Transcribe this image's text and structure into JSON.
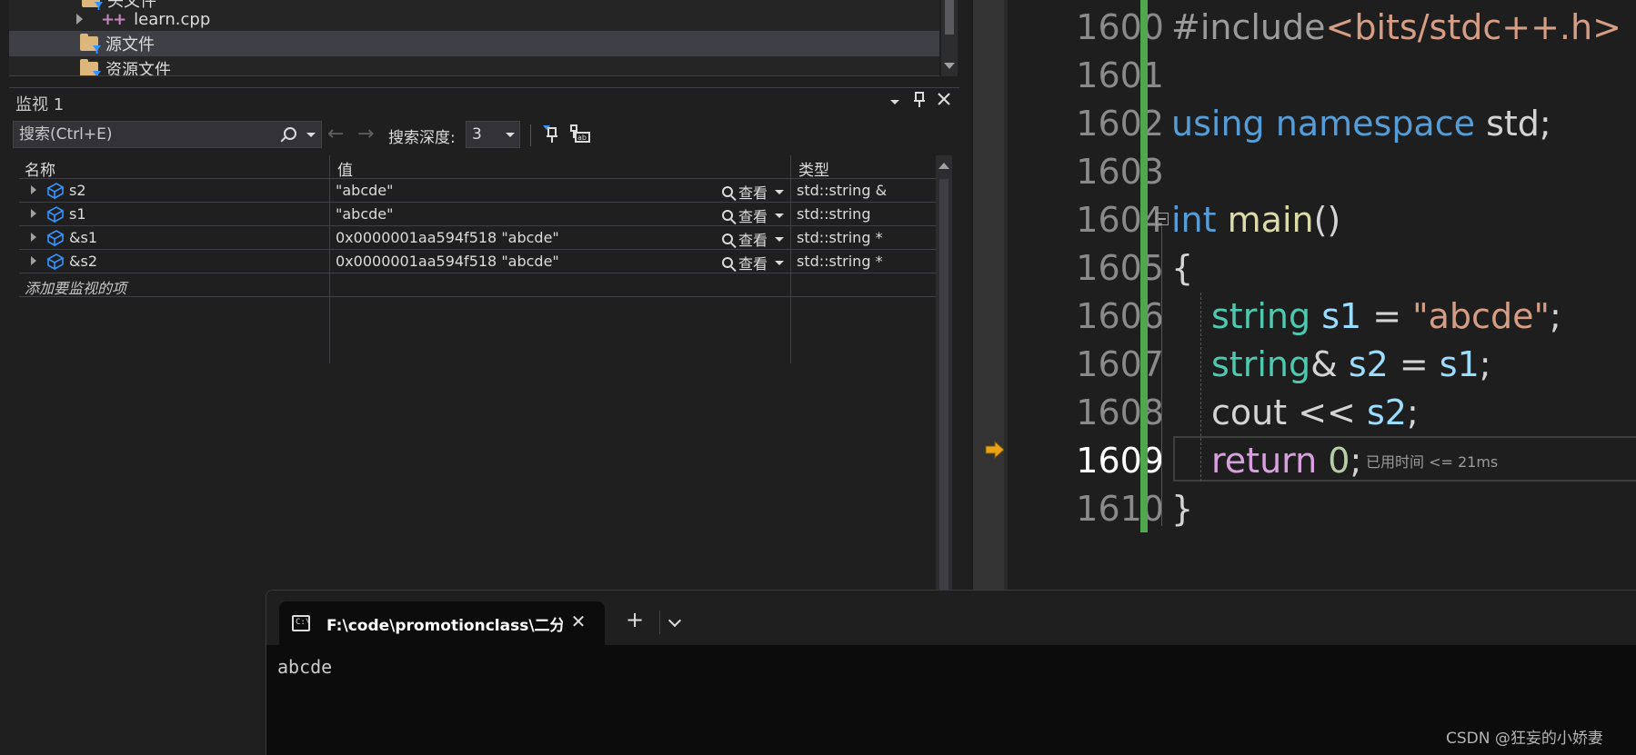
{
  "solution_explorer": {
    "items": [
      {
        "label": "头文件"
      },
      {
        "label": "learn.cpp"
      },
      {
        "label": "源文件"
      },
      {
        "label": "资源文件"
      }
    ]
  },
  "watch": {
    "title": "监视 1",
    "search_placeholder": "搜索(Ctrl+E)",
    "depth_label": "搜索深度:",
    "depth_value": "3",
    "columns": {
      "name": "名称",
      "value": "值",
      "type": "类型"
    },
    "view_label": "查看",
    "rows": [
      {
        "name": "s2",
        "value": "\"abcde\"",
        "type": "std::string &"
      },
      {
        "name": "s1",
        "value": "\"abcde\"",
        "type": "std::string"
      },
      {
        "name": "&s1",
        "value": "0x0000001aa594f518 \"abcde\"",
        "type": "std::string *"
      },
      {
        "name": "&s2",
        "value": "0x0000001aa594f518 \"abcde\"",
        "type": "std::string *"
      }
    ],
    "add_item": "添加要监视的项"
  },
  "editor": {
    "line_numbers": [
      "1600",
      "1601",
      "1602",
      "1603",
      "1604",
      "1605",
      "1606",
      "1607",
      "1608",
      "1609",
      "1610"
    ],
    "current_line": "1609",
    "perf_tip": "已用时间 <= 21ms",
    "code": {
      "l1600_a": "#include",
      "l1600_b": "<bits/stdc++.h>",
      "l1602_a": "using",
      "l1602_b": "namespace",
      "l1602_c": "std;",
      "l1604_a": "int",
      "l1604_b": "main",
      "l1604_c": "()",
      "l1605": "{",
      "l1606_a": "string",
      "l1606_b": "s1",
      "l1606_c": " = ",
      "l1606_d": "\"abcde\"",
      "l1606_e": ";",
      "l1607_a": "string",
      "l1607_b": "& ",
      "l1607_c": "s2",
      "l1607_d": " = ",
      "l1607_e": "s1",
      "l1607_f": ";",
      "l1608_a": "cout << ",
      "l1608_b": "s2",
      "l1608_c": ";",
      "l1609_a": "return",
      "l1609_b": "0",
      "l1609_c": ";",
      "l1610": "}"
    }
  },
  "terminal": {
    "tab_title": "F:\\code\\promotionclass\\二分查",
    "output": "abcde"
  },
  "watermark": "CSDN @狂妄的小娇妻",
  "colors": {
    "change_bar": "#4fa84b",
    "exec_arrow": "#e8a317",
    "keyword": "#569cd6",
    "type": "#4ec9b0",
    "string": "#d69d85"
  }
}
